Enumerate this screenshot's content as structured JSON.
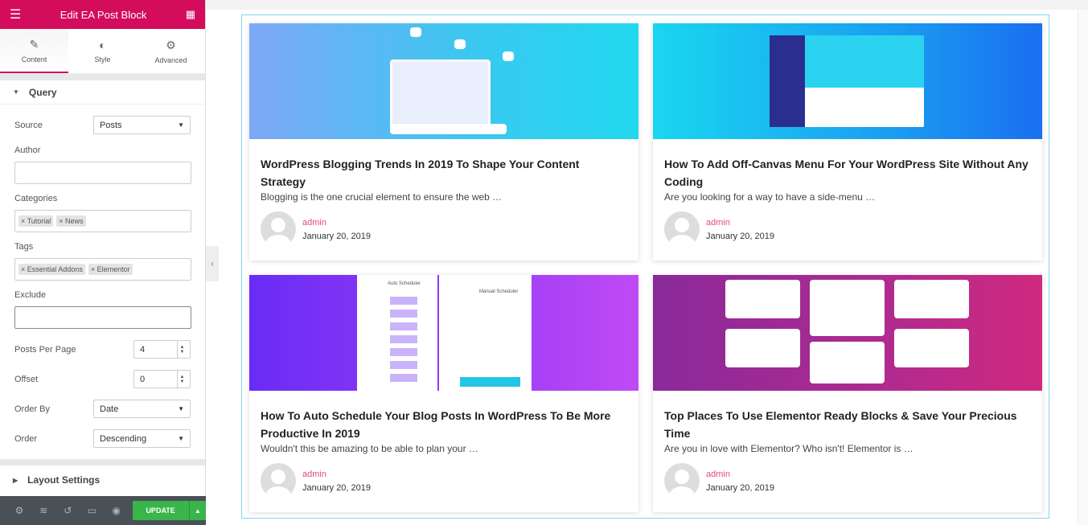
{
  "editor": {
    "title": "Edit EA Post Block",
    "menu_icon": "hamburger-icon",
    "apps_icon": "grid-icon",
    "tabs": [
      {
        "label": "Content",
        "icon": "pencil-icon"
      },
      {
        "label": "Style",
        "icon": "contrast-icon"
      },
      {
        "label": "Advanced",
        "icon": "gear-icon"
      }
    ],
    "query_section": "Query",
    "source": {
      "label": "Source",
      "value": "Posts"
    },
    "author": {
      "label": "Author",
      "value": ""
    },
    "categories": {
      "label": "Categories",
      "tags": [
        "Tutorial",
        "News"
      ]
    },
    "tags": {
      "label": "Tags",
      "tags": [
        "Essential Addons",
        "Elementor"
      ]
    },
    "exclude": {
      "label": "Exclude",
      "value": ""
    },
    "posts_per_page": {
      "label": "Posts Per Page",
      "value": "4"
    },
    "offset": {
      "label": "Offset",
      "value": "0"
    },
    "order_by": {
      "label": "Order By",
      "value": "Date"
    },
    "order": {
      "label": "Order",
      "value": "Descending"
    },
    "layout_section": "Layout Settings",
    "footer": {
      "update_label": "UPDATE",
      "icons": [
        "gear-icon",
        "layers-icon",
        "history-icon",
        "desktop-icon",
        "eye-icon"
      ]
    }
  },
  "colors": {
    "brand": "#d30c5c",
    "update": "#39b54a",
    "author": "#e2498a"
  },
  "posts": [
    {
      "title": "WordPress Blogging Trends In 2019 To Shape Your Content Strategy",
      "excerpt": "Blogging is the one crucial element to ensure the web …",
      "author": "admin",
      "date": "January 20, 2019"
    },
    {
      "title": "How To Add Off-Canvas Menu For Your WordPress Site Without Any Coding",
      "excerpt": "Are you looking for a way to have a side-menu …",
      "author": "admin",
      "date": "January 20, 2019"
    },
    {
      "title": "How To Auto Schedule Your Blog Posts In WordPress To Be More Productive In 2019",
      "excerpt": "Wouldn't this be amazing to be able to plan your …",
      "author": "admin",
      "date": "January 20, 2019",
      "img_labels": [
        "Auto Scheduler",
        "Manual Scheduler"
      ]
    },
    {
      "title": "Top Places To Use Elementor Ready Blocks & Save Your Precious Time",
      "excerpt": "Are you in love with Elementor? Who isn't! Elementor is …",
      "author": "admin",
      "date": "January 20, 2019"
    }
  ]
}
